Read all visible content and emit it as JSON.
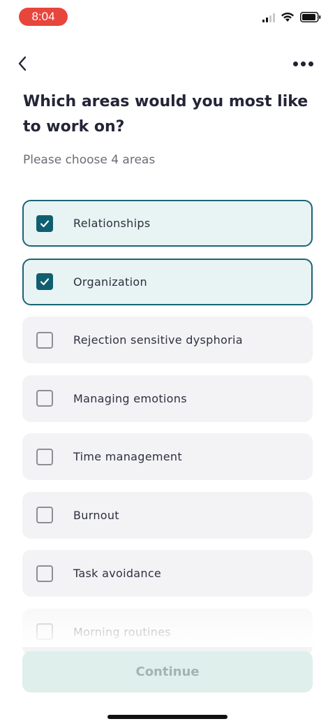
{
  "status_bar": {
    "time": "8:04",
    "icons": [
      "signal-icon",
      "wifi-icon",
      "battery-icon"
    ]
  },
  "header": {
    "back_icon": "chevron-left-icon",
    "more_icon": "more-dots-icon"
  },
  "title": "Which areas would you most like to work on?",
  "subtitle": "Please choose 4 areas",
  "options": [
    {
      "label": "Relationships",
      "checked": true
    },
    {
      "label": "Organization",
      "checked": true
    },
    {
      "label": "Rejection sensitive dysphoria",
      "checked": false
    },
    {
      "label": "Managing emotions",
      "checked": false
    },
    {
      "label": "Time management",
      "checked": false
    },
    {
      "label": "Burnout",
      "checked": false
    },
    {
      "label": "Task avoidance",
      "checked": false
    },
    {
      "label": "Morning routines",
      "checked": false
    }
  ],
  "continue_label": "Continue",
  "colors": {
    "accent": "#0f5f70",
    "selected_bg": "#e8f3f3",
    "option_bg": "#f3f3f5",
    "continue_bg": "#deefec",
    "time_pill": "#e8453c"
  }
}
